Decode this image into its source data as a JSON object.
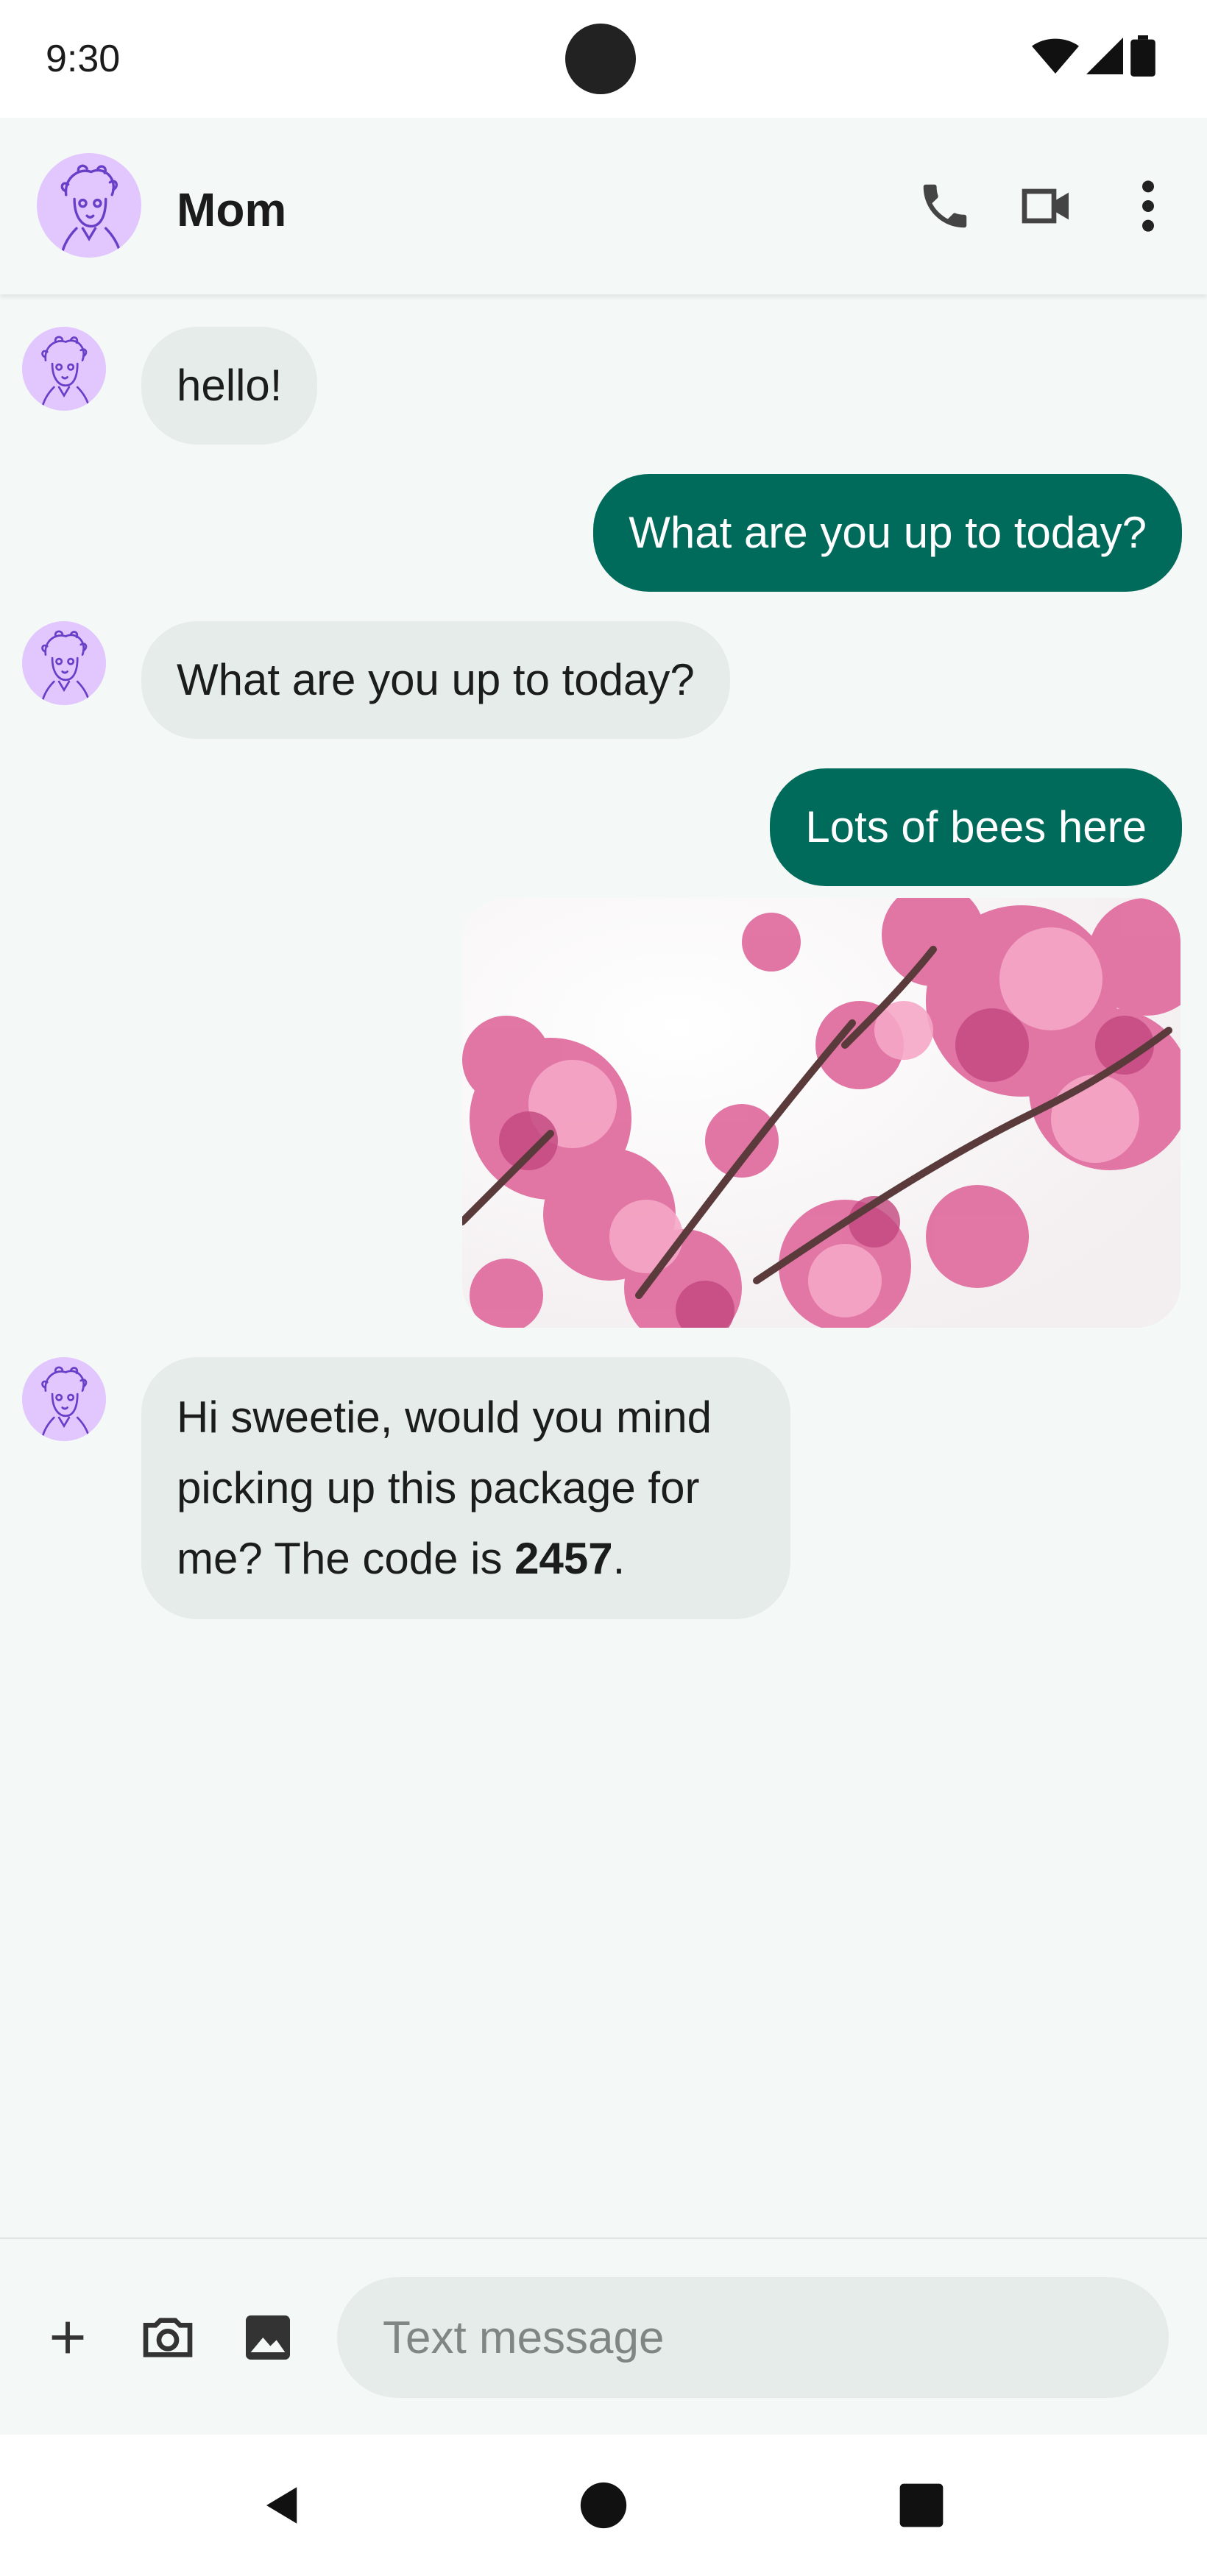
{
  "status_bar": {
    "time": "9:30"
  },
  "contact": {
    "name": "Mom"
  },
  "messages": [
    {
      "from": "contact",
      "text": "hello!"
    },
    {
      "from": "me",
      "text": "What are you up to today?"
    },
    {
      "from": "contact",
      "text": "What are you up to today?"
    },
    {
      "from": "me",
      "text": "Lots of bees here"
    },
    {
      "from": "me",
      "type": "image",
      "subject": "pink cherry blossoms"
    },
    {
      "from": "contact",
      "text_before": "Hi sweetie, would you mind picking up this package for me? The code is ",
      "code": "2457",
      "text_after": "."
    }
  ],
  "composer": {
    "placeholder": "Text message"
  },
  "colors": {
    "outgoing_bubble": "#006b5b",
    "incoming_bubble": "#e6ecea",
    "background": "#f4f9f7",
    "avatar": "#e2c7ff"
  },
  "icons": [
    "phone-icon",
    "video-call-icon",
    "more-vert-icon",
    "add-icon",
    "camera-icon",
    "image-icon",
    "back-nav-icon",
    "home-nav-icon",
    "recents-nav-icon"
  ]
}
